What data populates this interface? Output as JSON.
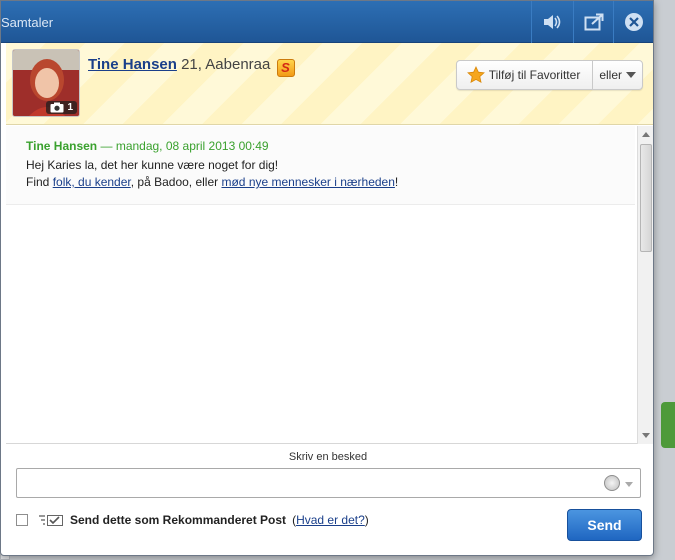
{
  "window": {
    "title": "Samtaler"
  },
  "profile": {
    "name": "Tine Hansen",
    "meta": "21, Aabenraa",
    "photo_count": "1",
    "super_badge": "S",
    "favorite_label": "Tilføj til Favoritter",
    "or_label": "eller"
  },
  "message": {
    "sender": "Tine Hansen",
    "timestamp": "— mandag, 08 april 2013 00:49",
    "line1": "Hej Karies la, det her kunne være noget for dig!",
    "line2_prefix": "Find ",
    "link1": "folk, du kender",
    "line2_middle": ", på Badoo, eller ",
    "link2": "mød nye mennesker i nærheden",
    "line2_suffix": "!"
  },
  "compose": {
    "label": "Skriv en besked",
    "value": "",
    "placeholder": ""
  },
  "footer": {
    "recommended_label": "Send dette som Rekommanderet Post",
    "paren_open": "(",
    "what_link": "Hvad er det?",
    "paren_close": ")",
    "send_label": "Send"
  },
  "colors": {
    "titlebar": "#2d6fb4",
    "send_button": "#1f66c1",
    "link": "#1a3f8a",
    "sender": "#3aa12e"
  }
}
